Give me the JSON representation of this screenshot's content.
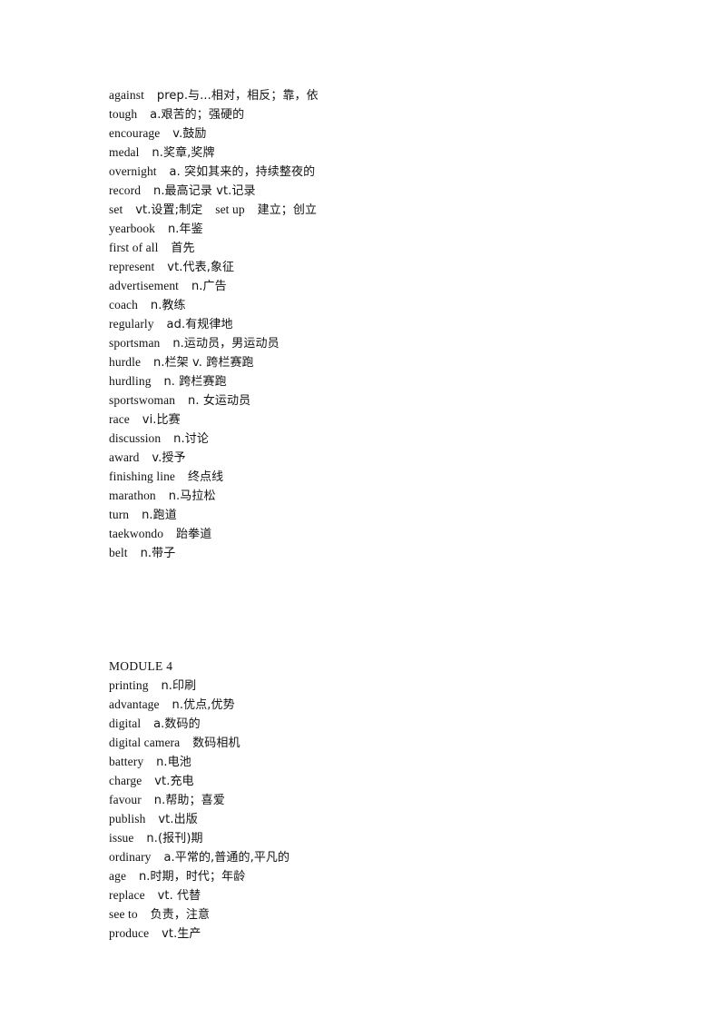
{
  "document": {
    "type": "vocabulary-list",
    "background_color": "#ffffff",
    "text_color": "#131313"
  },
  "sections": [
    {
      "id": "section-continued",
      "heading": null,
      "entries": [
        {
          "term": "against",
          "sep": "    ",
          "gloss": "prep.与...相对，相反；靠，依"
        },
        {
          "term": "tough",
          "sep": "    ",
          "gloss": "a.艰苦的；强硬的"
        },
        {
          "term": "encourage",
          "sep": "    ",
          "gloss": "v.鼓励"
        },
        {
          "term": "medal",
          "sep": "    ",
          "gloss": "n.奖章,奖牌"
        },
        {
          "term": "overnight",
          "sep": "    ",
          "gloss": "a. 突如其来的，持续整夜的"
        },
        {
          "term": "record",
          "sep": "    ",
          "gloss": "n.最高记录 vt.记录"
        },
        {
          "term": "set",
          "sep": "    ",
          "gloss": "vt.设置;制定",
          "term2": "set up",
          "sep2": "    ",
          "gloss2": "建立；创立"
        },
        {
          "term": "yearbook",
          "sep": "    ",
          "gloss": "n.年鉴"
        },
        {
          "term": "first of all",
          "sep": "    ",
          "gloss": "首先"
        },
        {
          "term": "represent",
          "sep": "    ",
          "gloss": "vt.代表,象征"
        },
        {
          "term": "advertisement",
          "sep": "    ",
          "gloss": "n.广告"
        },
        {
          "term": "coach",
          "sep": "    ",
          "gloss": "n.教练"
        },
        {
          "term": "regularly",
          "sep": "    ",
          "gloss": "ad.有规律地"
        },
        {
          "term": "sportsman",
          "sep": "    ",
          "gloss": "n.运动员，男运动员"
        },
        {
          "term": "hurdle",
          "sep": "    ",
          "gloss": "n.栏架 v. 跨栏赛跑"
        },
        {
          "term": "hurdling",
          "sep": "    ",
          "gloss": "n. 跨栏赛跑"
        },
        {
          "term": "sportswoman",
          "sep": "    ",
          "gloss": "n. 女运动员"
        },
        {
          "term": "race",
          "sep": "    ",
          "gloss": "vi.比赛"
        },
        {
          "term": "discussion",
          "sep": "    ",
          "gloss": "n.讨论"
        },
        {
          "term": "award",
          "sep": "    ",
          "gloss": "v.授予"
        },
        {
          "term": "finishing line",
          "sep": "    ",
          "gloss": "终点线"
        },
        {
          "term": "marathon",
          "sep": "    ",
          "gloss": "n.马拉松"
        },
        {
          "term": "turn",
          "sep": "    ",
          "gloss": "n.跑道"
        },
        {
          "term": "taekwondo",
          "sep": "    ",
          "gloss": "跆拳道"
        },
        {
          "term": "belt",
          "sep": "    ",
          "gloss": "n.带子"
        }
      ]
    },
    {
      "id": "section-module-4",
      "heading": "MODULE 4",
      "entries": [
        {
          "term": "printing",
          "sep": "    ",
          "gloss": "n.印刷"
        },
        {
          "term": "advantage",
          "sep": "    ",
          "gloss": "n.优点,优势"
        },
        {
          "term": "digital",
          "sep": "    ",
          "gloss": "a.数码的"
        },
        {
          "term": "digital camera",
          "sep": "    ",
          "gloss": "数码相机"
        },
        {
          "term": "battery",
          "sep": "    ",
          "gloss": "n.电池"
        },
        {
          "term": "charge",
          "sep": "    ",
          "gloss": "vt.充电"
        },
        {
          "term": "favour",
          "sep": "    ",
          "gloss": "n.帮助；喜爱"
        },
        {
          "term": "publish",
          "sep": "    ",
          "gloss": "vt.出版"
        },
        {
          "term": "issue",
          "sep": "    ",
          "gloss": "n.(报刊)期"
        },
        {
          "term": "ordinary",
          "sep": "    ",
          "gloss": "a.平常的,普通的,平凡的"
        },
        {
          "term": "age",
          "sep": "    ",
          "gloss": "n.时期，时代；年龄"
        },
        {
          "term": "replace",
          "sep": "    ",
          "gloss": "vt. 代替"
        },
        {
          "term": "see to",
          "sep": "    ",
          "gloss": "负责，注意"
        },
        {
          "term": "produce",
          "sep": "    ",
          "gloss": "vt.生产"
        }
      ]
    }
  ]
}
